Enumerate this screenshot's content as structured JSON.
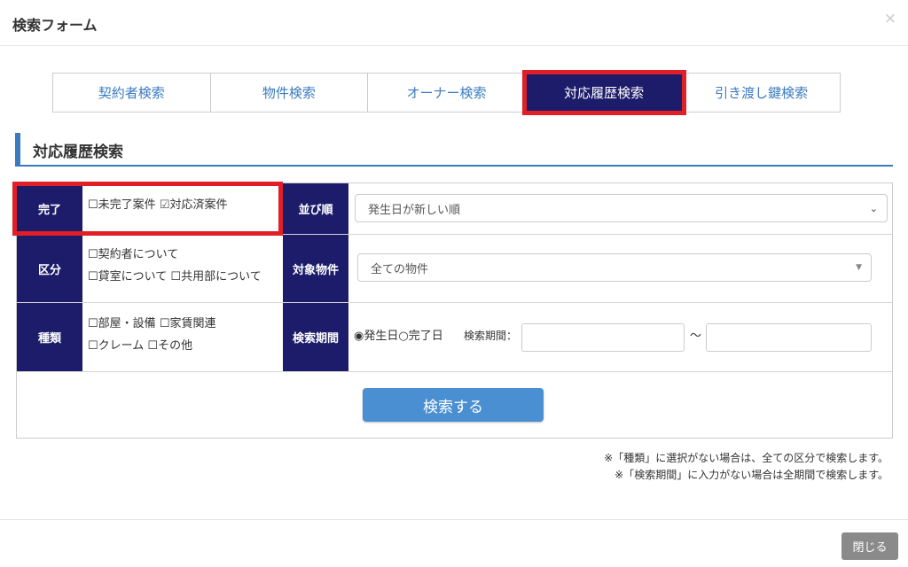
{
  "modal": {
    "title": "検索フォーム",
    "close_symbol": "×",
    "close_button": "閉じる"
  },
  "tabs": [
    {
      "label": "契約者検索"
    },
    {
      "label": "物件検索"
    },
    {
      "label": "オーナー検索"
    },
    {
      "label": "対応履歴検索",
      "active": true
    },
    {
      "label": "引き渡し鍵検索"
    }
  ],
  "section": {
    "title": "対応履歴検索"
  },
  "form": {
    "status": {
      "label": "完了",
      "options": [
        {
          "label": "未完了案件",
          "checked": false
        },
        {
          "label": "対応済案件",
          "checked": true
        }
      ]
    },
    "sort": {
      "label": "並び順",
      "value": "発生日が新しい順"
    },
    "category": {
      "label": "区分",
      "options": [
        {
          "label": "契約者について",
          "checked": false
        },
        {
          "label": "貸室について",
          "checked": false
        },
        {
          "label": "共用部について",
          "checked": false
        }
      ]
    },
    "property": {
      "label": "対象物件",
      "value": "全ての物件"
    },
    "type": {
      "label": "種類",
      "options": [
        {
          "label": "部屋・設備",
          "checked": false
        },
        {
          "label": "家賃関連",
          "checked": false
        },
        {
          "label": "クレーム",
          "checked": false
        },
        {
          "label": "その他",
          "checked": false
        }
      ]
    },
    "period": {
      "label": "検索期間",
      "radios": [
        {
          "label": "発生日",
          "selected": true
        },
        {
          "label": "完了日",
          "selected": false
        }
      ],
      "range_label": "検索期間：",
      "separator": "～",
      "from_value": "",
      "to_value": ""
    },
    "search_button": "検索する"
  },
  "notes": [
    "※「種類」に選択がない場合は、全ての区分で検索します。",
    "※「検索期間」に入力がない場合は全期間で検索します。"
  ],
  "colors": {
    "label_bg": "#1c1c6b",
    "accent_blue": "#3a7bbf",
    "highlight_red": "#e01f26",
    "button_blue": "#4a8fd1"
  }
}
